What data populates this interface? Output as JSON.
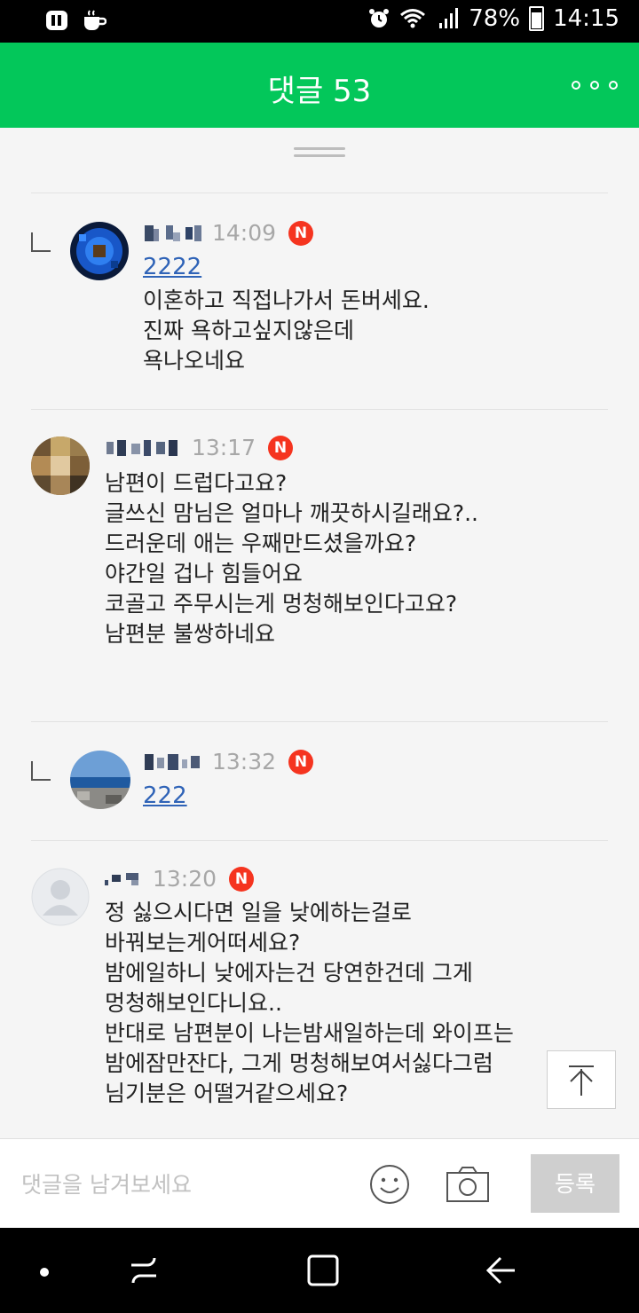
{
  "status_bar": {
    "battery": "78%",
    "time": "14:15"
  },
  "header": {
    "title": "댓글 53"
  },
  "comments": [
    {
      "is_reply": true,
      "time": "14:09",
      "badge": "N",
      "mention": "2222",
      "text": "이혼하고 직접나가서 돈버세요.\n진짜 욕하고싶지않은데\n욕나오네요"
    },
    {
      "is_reply": false,
      "time": "13:17",
      "badge": "N",
      "text": "남편이 드럽다고요?\n글쓰신 맘님은 얼마나 깨끗하시길래요?..\n드러운데 애는 우째만드셨을까요?\n야간일 겁나 힘들어요\n코골고 주무시는게 멍청해보인다고요?\n남편분 불쌍하네요"
    },
    {
      "is_reply": true,
      "time": "13:32",
      "badge": "N",
      "mention": "222"
    },
    {
      "is_reply": false,
      "time": "13:20",
      "badge": "N",
      "text": "정 싫으시다면 일을 낮에하는걸로\n바꿔보는게어떠세요?\n밤에일하니 낮에자는건 당연한건데 그게\n멍청해보인다니요..\n반대로 남편분이 나는밤새일하는데 와이프는\n밤에잠만잔다, 그게 멍청해보여서싫다그럼\n님기분은 어떨거같으세요?"
    }
  ],
  "input_bar": {
    "placeholder": "댓글을 남겨보세요",
    "submit_label": "등록",
    "emoji_icon": "smiley-icon",
    "camera_icon": "camera-icon"
  },
  "colors": {
    "header_green": "#03c75a",
    "badge_red": "#f5341f",
    "mention_blue": "#2f63b7"
  }
}
